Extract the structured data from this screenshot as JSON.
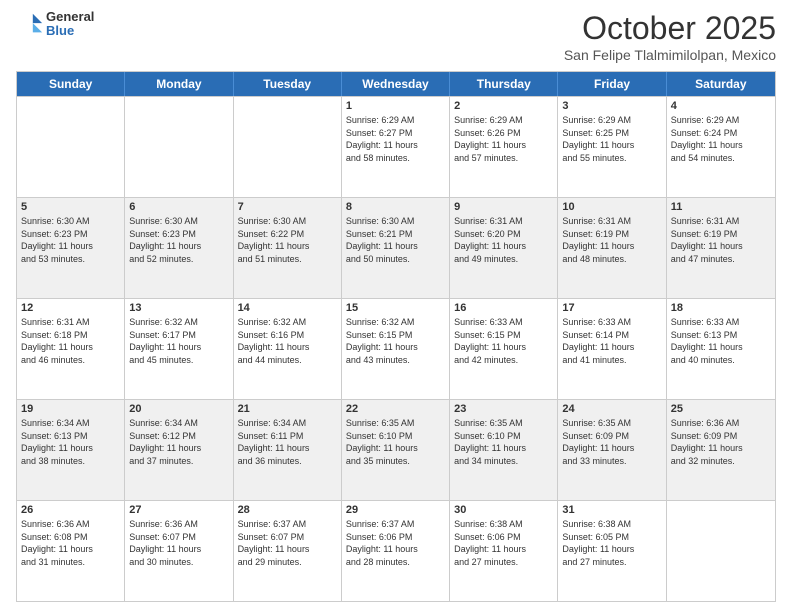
{
  "logo": {
    "general": "General",
    "blue": "Blue"
  },
  "header": {
    "month": "October 2025",
    "location": "San Felipe Tlalmimilolpan, Mexico"
  },
  "weekdays": [
    "Sunday",
    "Monday",
    "Tuesday",
    "Wednesday",
    "Thursday",
    "Friday",
    "Saturday"
  ],
  "weeks": [
    [
      {
        "date": "",
        "info": ""
      },
      {
        "date": "",
        "info": ""
      },
      {
        "date": "",
        "info": ""
      },
      {
        "date": "1",
        "info": "Sunrise: 6:29 AM\nSunset: 6:27 PM\nDaylight: 11 hours\nand 58 minutes."
      },
      {
        "date": "2",
        "info": "Sunrise: 6:29 AM\nSunset: 6:26 PM\nDaylight: 11 hours\nand 57 minutes."
      },
      {
        "date": "3",
        "info": "Sunrise: 6:29 AM\nSunset: 6:25 PM\nDaylight: 11 hours\nand 55 minutes."
      },
      {
        "date": "4",
        "info": "Sunrise: 6:29 AM\nSunset: 6:24 PM\nDaylight: 11 hours\nand 54 minutes."
      }
    ],
    [
      {
        "date": "5",
        "info": "Sunrise: 6:30 AM\nSunset: 6:23 PM\nDaylight: 11 hours\nand 53 minutes."
      },
      {
        "date": "6",
        "info": "Sunrise: 6:30 AM\nSunset: 6:23 PM\nDaylight: 11 hours\nand 52 minutes."
      },
      {
        "date": "7",
        "info": "Sunrise: 6:30 AM\nSunset: 6:22 PM\nDaylight: 11 hours\nand 51 minutes."
      },
      {
        "date": "8",
        "info": "Sunrise: 6:30 AM\nSunset: 6:21 PM\nDaylight: 11 hours\nand 50 minutes."
      },
      {
        "date": "9",
        "info": "Sunrise: 6:31 AM\nSunset: 6:20 PM\nDaylight: 11 hours\nand 49 minutes."
      },
      {
        "date": "10",
        "info": "Sunrise: 6:31 AM\nSunset: 6:19 PM\nDaylight: 11 hours\nand 48 minutes."
      },
      {
        "date": "11",
        "info": "Sunrise: 6:31 AM\nSunset: 6:19 PM\nDaylight: 11 hours\nand 47 minutes."
      }
    ],
    [
      {
        "date": "12",
        "info": "Sunrise: 6:31 AM\nSunset: 6:18 PM\nDaylight: 11 hours\nand 46 minutes."
      },
      {
        "date": "13",
        "info": "Sunrise: 6:32 AM\nSunset: 6:17 PM\nDaylight: 11 hours\nand 45 minutes."
      },
      {
        "date": "14",
        "info": "Sunrise: 6:32 AM\nSunset: 6:16 PM\nDaylight: 11 hours\nand 44 minutes."
      },
      {
        "date": "15",
        "info": "Sunrise: 6:32 AM\nSunset: 6:15 PM\nDaylight: 11 hours\nand 43 minutes."
      },
      {
        "date": "16",
        "info": "Sunrise: 6:33 AM\nSunset: 6:15 PM\nDaylight: 11 hours\nand 42 minutes."
      },
      {
        "date": "17",
        "info": "Sunrise: 6:33 AM\nSunset: 6:14 PM\nDaylight: 11 hours\nand 41 minutes."
      },
      {
        "date": "18",
        "info": "Sunrise: 6:33 AM\nSunset: 6:13 PM\nDaylight: 11 hours\nand 40 minutes."
      }
    ],
    [
      {
        "date": "19",
        "info": "Sunrise: 6:34 AM\nSunset: 6:13 PM\nDaylight: 11 hours\nand 38 minutes."
      },
      {
        "date": "20",
        "info": "Sunrise: 6:34 AM\nSunset: 6:12 PM\nDaylight: 11 hours\nand 37 minutes."
      },
      {
        "date": "21",
        "info": "Sunrise: 6:34 AM\nSunset: 6:11 PM\nDaylight: 11 hours\nand 36 minutes."
      },
      {
        "date": "22",
        "info": "Sunrise: 6:35 AM\nSunset: 6:10 PM\nDaylight: 11 hours\nand 35 minutes."
      },
      {
        "date": "23",
        "info": "Sunrise: 6:35 AM\nSunset: 6:10 PM\nDaylight: 11 hours\nand 34 minutes."
      },
      {
        "date": "24",
        "info": "Sunrise: 6:35 AM\nSunset: 6:09 PM\nDaylight: 11 hours\nand 33 minutes."
      },
      {
        "date": "25",
        "info": "Sunrise: 6:36 AM\nSunset: 6:09 PM\nDaylight: 11 hours\nand 32 minutes."
      }
    ],
    [
      {
        "date": "26",
        "info": "Sunrise: 6:36 AM\nSunset: 6:08 PM\nDaylight: 11 hours\nand 31 minutes."
      },
      {
        "date": "27",
        "info": "Sunrise: 6:36 AM\nSunset: 6:07 PM\nDaylight: 11 hours\nand 30 minutes."
      },
      {
        "date": "28",
        "info": "Sunrise: 6:37 AM\nSunset: 6:07 PM\nDaylight: 11 hours\nand 29 minutes."
      },
      {
        "date": "29",
        "info": "Sunrise: 6:37 AM\nSunset: 6:06 PM\nDaylight: 11 hours\nand 28 minutes."
      },
      {
        "date": "30",
        "info": "Sunrise: 6:38 AM\nSunset: 6:06 PM\nDaylight: 11 hours\nand 27 minutes."
      },
      {
        "date": "31",
        "info": "Sunrise: 6:38 AM\nSunset: 6:05 PM\nDaylight: 11 hours\nand 27 minutes."
      },
      {
        "date": "",
        "info": ""
      }
    ]
  ]
}
